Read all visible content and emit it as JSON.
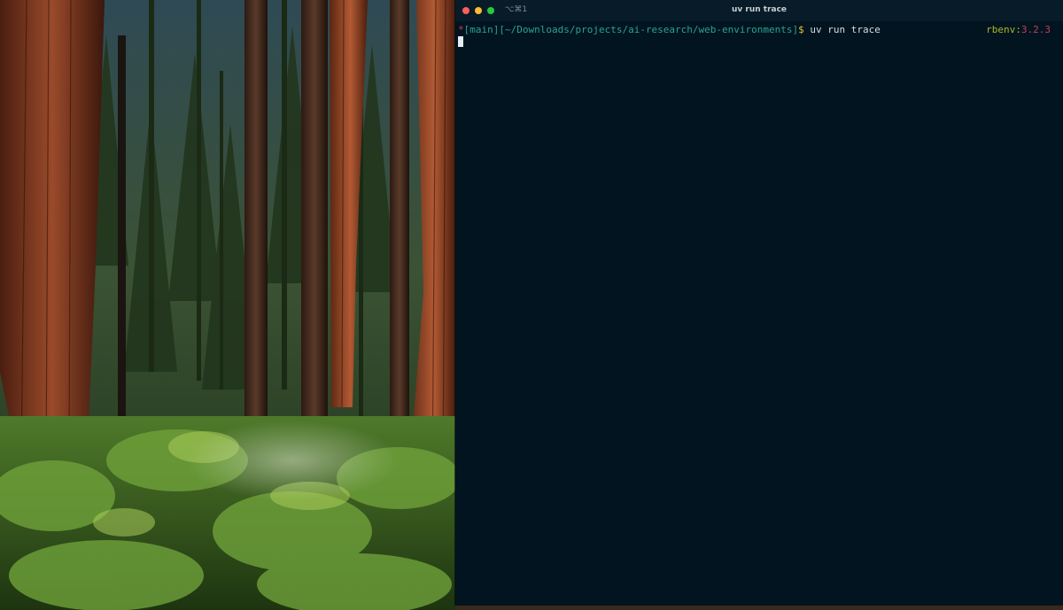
{
  "terminal": {
    "window_title": "uv run trace",
    "shortcut": "⌥⌘1",
    "prompt": {
      "marker": "*",
      "bracket_open": "[",
      "branch": "main",
      "bracket_close": "]",
      "path": "[~/Downloads/projects/ai-research/web-environments]",
      "dollar": "$",
      "command": " uv run trace"
    },
    "rbenv": {
      "label": "rbenv",
      "colon": ":",
      "version": "3.2.3"
    }
  },
  "colors": {
    "terminal_bg": "#01141f",
    "prompt_cyan": "#2aa198",
    "prompt_yellow": "#e3c13a",
    "rbenv_green": "#a8b72a",
    "rbenv_red": "#c23f5f"
  },
  "icons": [
    "close-icon",
    "minimize-icon",
    "maximize-icon"
  ]
}
